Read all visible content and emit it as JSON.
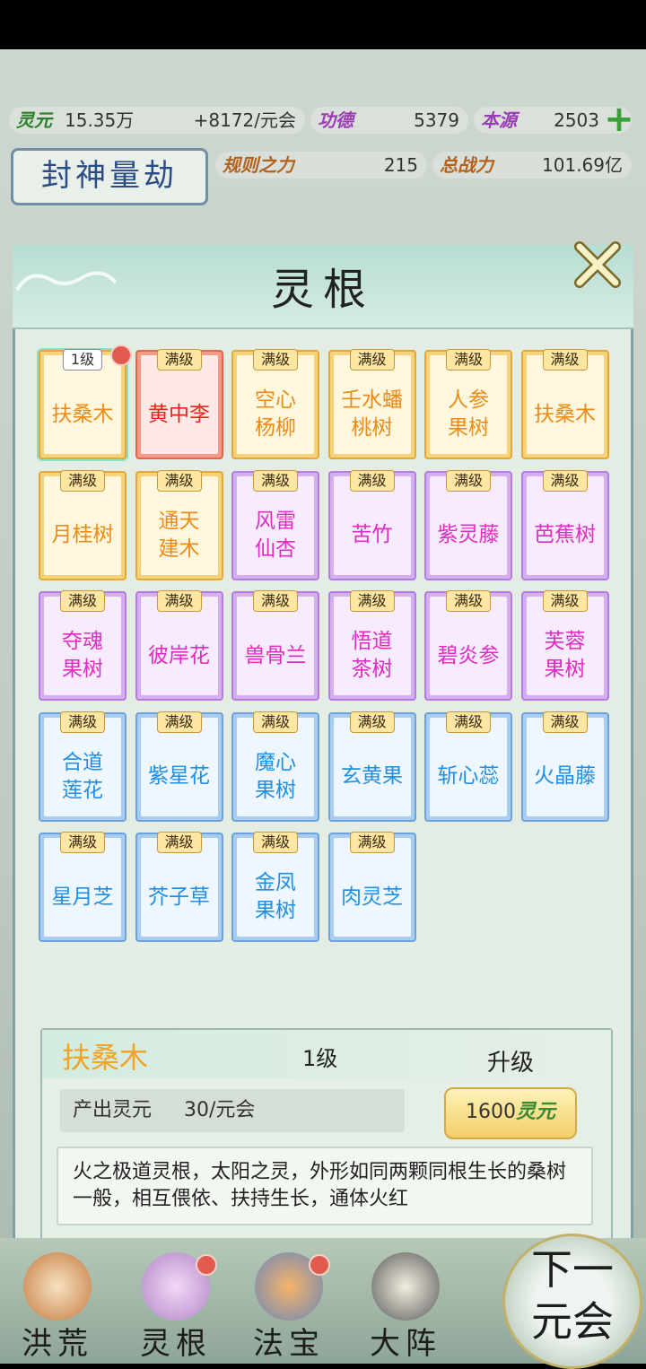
{
  "resources": {
    "lingyuan": {
      "label": "灵元",
      "value": "15.35万",
      "rate": "+8172/元会"
    },
    "gongde": {
      "label": "功德",
      "value": "5379"
    },
    "benyuan": {
      "label": "本源",
      "value": "2503"
    },
    "guize": {
      "label": "规则之力",
      "value": "215"
    },
    "zhanli": {
      "label": "总战力",
      "value": "101.69亿"
    }
  },
  "event_button": "封神量劫",
  "panel": {
    "title": "灵根"
  },
  "cards": [
    {
      "name": "扶桑木",
      "level": "1级",
      "rarity": "orange",
      "selected": true,
      "dot": true
    },
    {
      "name": "黄中李",
      "level": "满级",
      "rarity": "red"
    },
    {
      "name": "空心杨柳",
      "level": "满级",
      "rarity": "orange"
    },
    {
      "name": "壬水蟠桃树",
      "level": "满级",
      "rarity": "orange"
    },
    {
      "name": "人参果树",
      "level": "满级",
      "rarity": "orange"
    },
    {
      "name": "扶桑木",
      "level": "满级",
      "rarity": "orange"
    },
    {
      "name": "月桂树",
      "level": "满级",
      "rarity": "orange"
    },
    {
      "name": "通天建木",
      "level": "满级",
      "rarity": "orange"
    },
    {
      "name": "风雷仙杏",
      "level": "满级",
      "rarity": "purple"
    },
    {
      "name": "苦竹",
      "level": "满级",
      "rarity": "purple"
    },
    {
      "name": "紫灵藤",
      "level": "满级",
      "rarity": "purple"
    },
    {
      "name": "芭蕉树",
      "level": "满级",
      "rarity": "purple"
    },
    {
      "name": "夺魂果树",
      "level": "满级",
      "rarity": "purple"
    },
    {
      "name": "彼岸花",
      "level": "满级",
      "rarity": "purple"
    },
    {
      "name": "兽骨兰",
      "level": "满级",
      "rarity": "purple"
    },
    {
      "name": "悟道茶树",
      "level": "满级",
      "rarity": "purple"
    },
    {
      "name": "碧炎参",
      "level": "满级",
      "rarity": "purple"
    },
    {
      "name": "芙蓉果树",
      "level": "满级",
      "rarity": "purple"
    },
    {
      "name": "合道莲花",
      "level": "满级",
      "rarity": "blue"
    },
    {
      "name": "紫星花",
      "level": "满级",
      "rarity": "blue"
    },
    {
      "name": "魔心果树",
      "level": "满级",
      "rarity": "blue"
    },
    {
      "name": "玄黄果",
      "level": "满级",
      "rarity": "blue"
    },
    {
      "name": "斩心蕊",
      "level": "满级",
      "rarity": "blue"
    },
    {
      "name": "火晶藤",
      "level": "满级",
      "rarity": "blue"
    },
    {
      "name": "星月芝",
      "level": "满级",
      "rarity": "blue"
    },
    {
      "name": "芥子草",
      "level": "满级",
      "rarity": "blue"
    },
    {
      "name": "金凤果树",
      "level": "满级",
      "rarity": "blue"
    },
    {
      "name": "肉灵芝",
      "level": "满级",
      "rarity": "blue"
    }
  ],
  "detail": {
    "name": "扶桑木",
    "level": "1级",
    "upgrade_label": "升级",
    "output_label": "产出灵元",
    "output_value": "30/元会",
    "cost_amount": "1600",
    "cost_unit": "灵元",
    "description": "火之极道灵根，太阳之灵，外形如同两颗同根生长的桑树一般，相互偎依、扶持生长，通体火红"
  },
  "nav": [
    {
      "label": "洪荒",
      "dot": false
    },
    {
      "label": "灵根",
      "dot": true
    },
    {
      "label": "法宝",
      "dot": true
    },
    {
      "label": "大阵",
      "dot": false
    }
  ],
  "next_button": "下一元会"
}
